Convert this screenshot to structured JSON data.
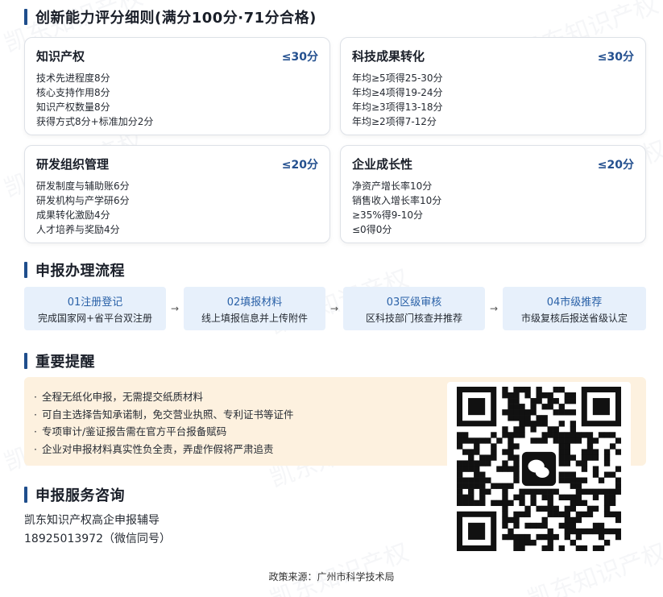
{
  "scoring": {
    "title": "创新能力评分细则(满分100分·71分合格)",
    "cards": [
      {
        "title": "知识产权",
        "limit": "≤30分",
        "items": [
          "技术先进程度8分",
          "核心支持作用8分",
          "知识产权数量8分",
          "获得方式8分+标准加分2分"
        ]
      },
      {
        "title": "科技成果转化",
        "limit": "≤30分",
        "items": [
          "年均≥5项得25-30分",
          "年均≥4项得19-24分",
          "年均≥3项得13-18分",
          "年均≥2项得7-12分"
        ]
      },
      {
        "title": "研发组织管理",
        "limit": "≤20分",
        "items": [
          "研发制度与辅助账6分",
          "研发机构与产学研6分",
          "成果转化激励4分",
          "人才培养与奖励4分"
        ]
      },
      {
        "title": "企业成长性",
        "limit": "≤20分",
        "items": [
          "净资产增长率10分",
          "销售收入增长率10分",
          "≥35%得9-10分",
          "≤0得0分"
        ]
      }
    ]
  },
  "process": {
    "title": "申报办理流程",
    "arrow": "→",
    "steps": [
      {
        "title": "01注册登记",
        "desc": "完成国家网+省平台双注册"
      },
      {
        "title": "02填报材料",
        "desc": "线上填报信息并上传附件"
      },
      {
        "title": "03区级审核",
        "desc": "区科技部门核查并推荐"
      },
      {
        "title": "04市级推荐",
        "desc": "市级复核后报送省级认定"
      }
    ]
  },
  "reminder": {
    "title": "重要提醒",
    "bullet": "·",
    "items": [
      "全程无纸化申报，无需提交纸质材料",
      "可自主选择告知承诺制，免交营业执照、专利证书等证件",
      "专项审计/鉴证报告需在官方平台报备赋码",
      "企业对申报材料真实性负全责，弄虚作假将严肃追责"
    ]
  },
  "consult": {
    "title": "申报服务咨询",
    "name": "凯东知识产权高企申报辅导",
    "phone": "18925013972（微信同号）"
  },
  "qr_icon": "wechat-logo",
  "source": "政策来源：广州市科学技术局",
  "watermark": "凯东知识产权",
  "colors": {
    "accent": "#1f4e8c",
    "limit": "#24508f",
    "step_bg": "#e7f0fb",
    "step_title": "#2b62a8",
    "reminder_bg": "#fdf1df",
    "wechat_green": "#1aad19"
  }
}
